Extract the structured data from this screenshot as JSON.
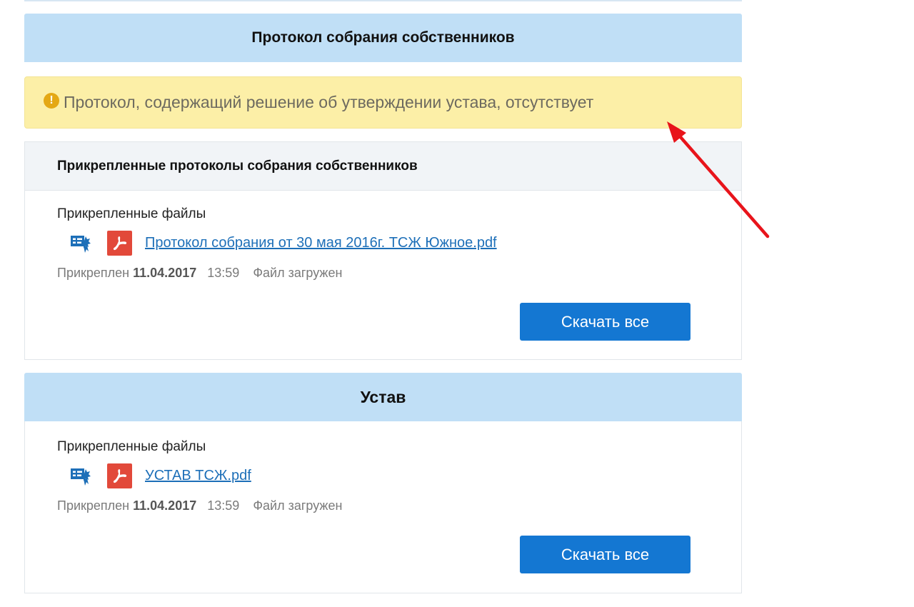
{
  "protocol_section": {
    "title": "Протокол собрания собственников",
    "alert_text": "Протокол, содержащий решение об утверждении устава, отсутствует",
    "attached_panel": {
      "header": "Прикрепленные протоколы собрания собственников",
      "files_label": "Прикрепленные файлы",
      "file_name": "Протокол собрания от 30 мая 2016г. ТСЖ Южное.pdf",
      "meta_prefix": "Прикреплен",
      "meta_date": "11.04.2017",
      "meta_time": "13:59",
      "meta_status": "Файл загружен",
      "download_label": "Скачать все"
    }
  },
  "charter_section": {
    "title": "Устав",
    "files_label": "Прикрепленные файлы",
    "file_name": "УСТАВ ТСЖ.pdf",
    "meta_prefix": "Прикреплен",
    "meta_date": "11.04.2017",
    "meta_time": "13:59",
    "meta_status": "Файл загружен",
    "download_label": "Скачать все"
  },
  "icons": {
    "alert": "exclamation-circle-icon",
    "signature": "certificate-signature-icon",
    "pdf": "pdf-file-icon",
    "annotation": "red-arrow"
  },
  "colors": {
    "header_bg": "#c0dff6",
    "alert_bg": "#fcefa7",
    "alert_icon": "#e4a814",
    "button": "#1477d2",
    "link": "#1d6fb8",
    "pdf_icon": "#e2493a",
    "arrow": "#e8141b"
  }
}
